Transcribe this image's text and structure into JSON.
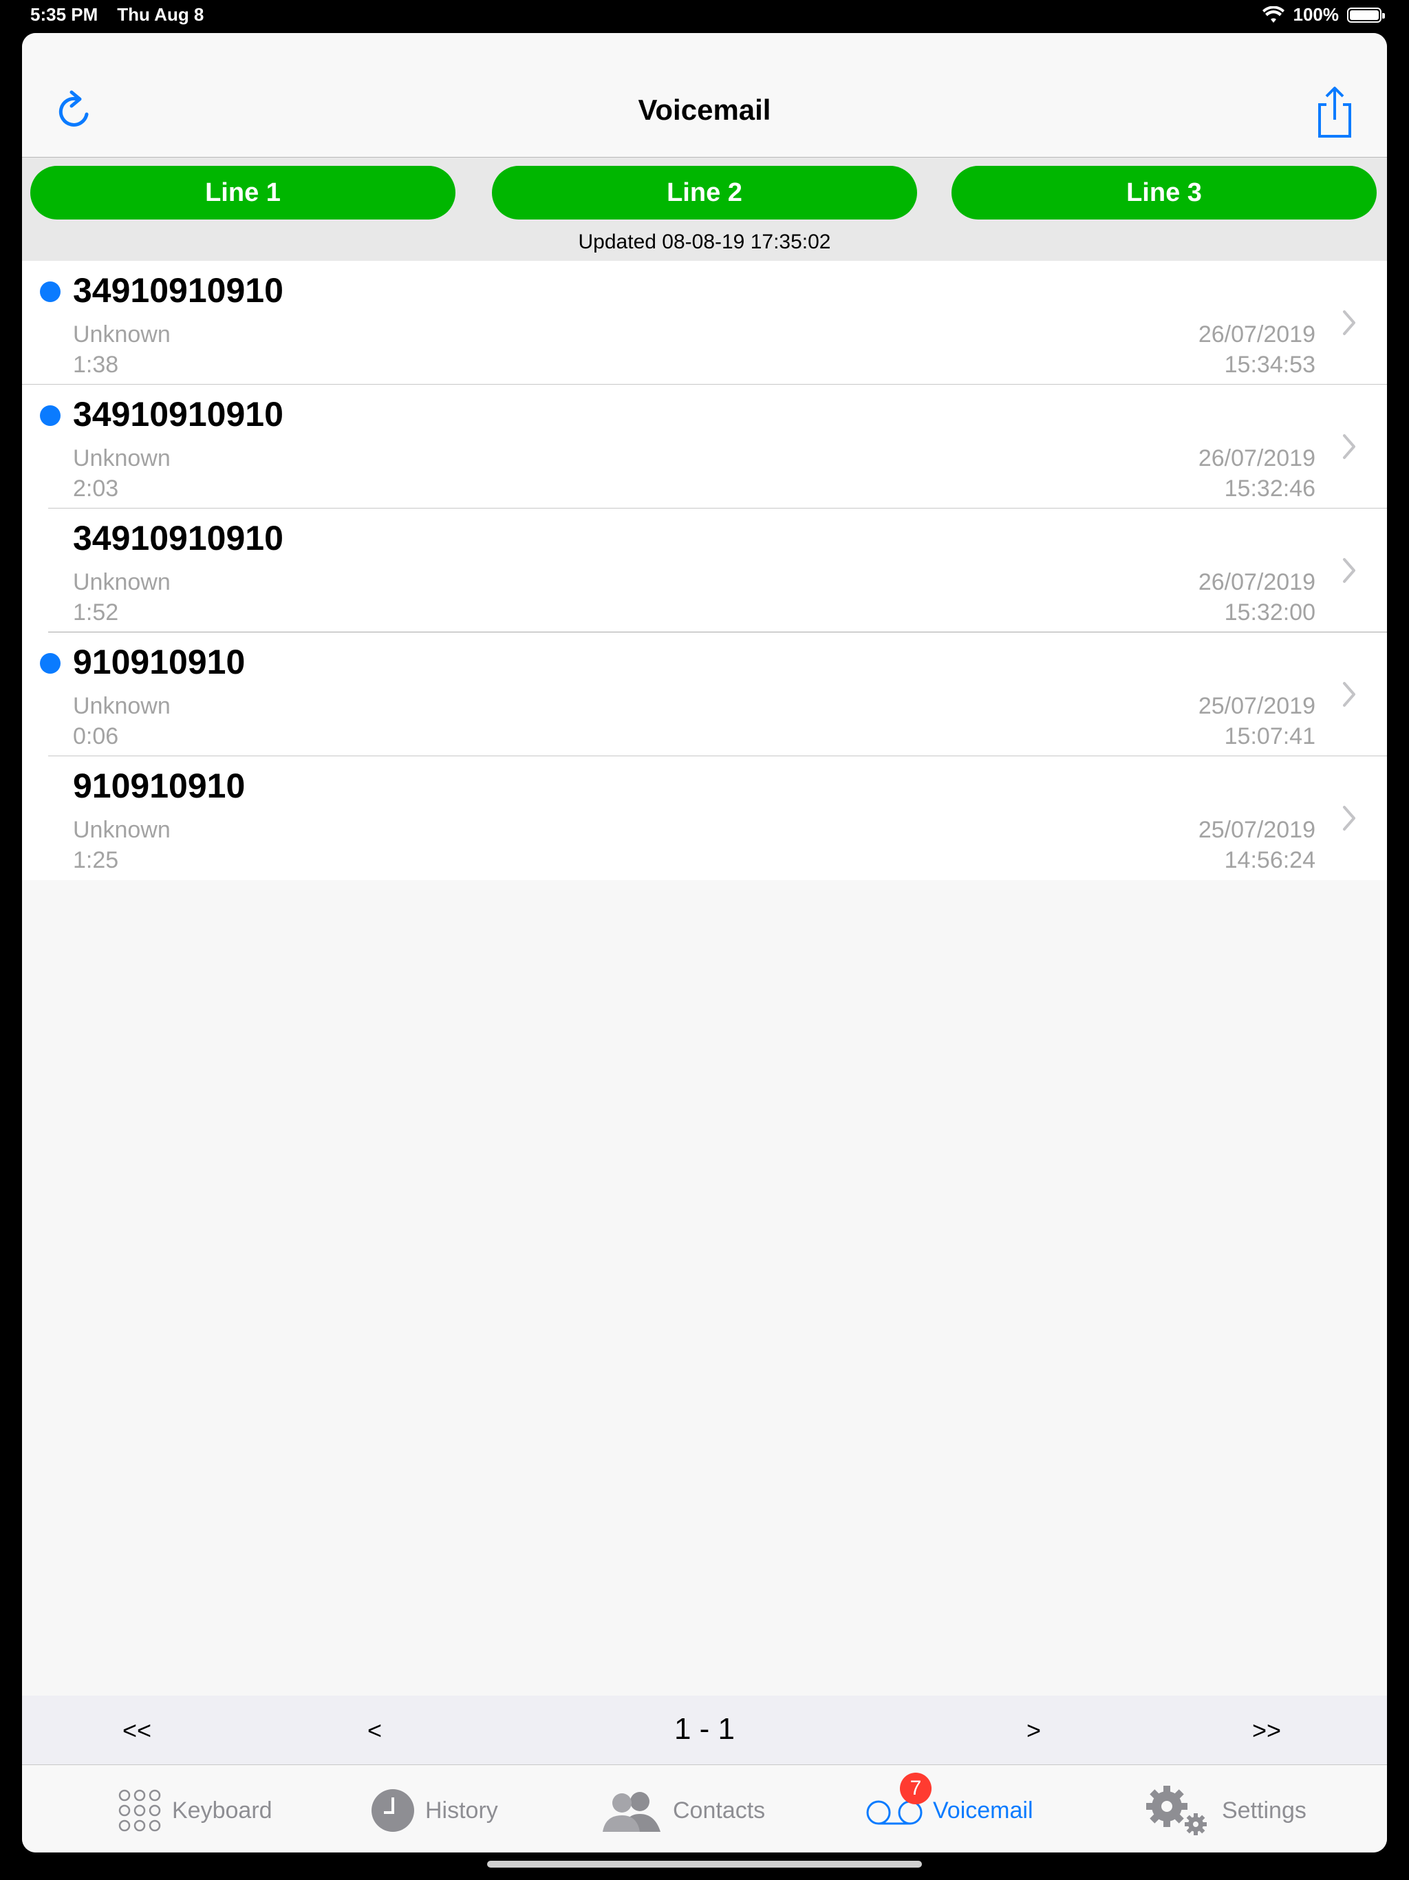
{
  "status_bar": {
    "time": "5:35 PM",
    "date": "Thu Aug 8",
    "battery": "100%",
    "battery_level": 1.0
  },
  "header": {
    "title": "Voicemail"
  },
  "lines": [
    {
      "label": "Line 1"
    },
    {
      "label": "Line 2"
    },
    {
      "label": "Line 3"
    }
  ],
  "updated_text": "Updated 08-08-19 17:35:02",
  "voicemails": [
    {
      "number": "34910910910",
      "name": "Unknown",
      "duration": "1:38",
      "date": "26/07/2019",
      "time": "15:34:53",
      "unread": true
    },
    {
      "number": "34910910910",
      "name": "Unknown",
      "duration": "2:03",
      "date": "26/07/2019",
      "time": "15:32:46",
      "unread": true
    },
    {
      "number": "34910910910",
      "name": "Unknown",
      "duration": "1:52",
      "date": "26/07/2019",
      "time": "15:32:00",
      "unread": false
    },
    {
      "number": "910910910",
      "name": "Unknown",
      "duration": "0:06",
      "date": "25/07/2019",
      "time": "15:07:41",
      "unread": true
    },
    {
      "number": "910910910",
      "name": "Unknown",
      "duration": "1:25",
      "date": "25/07/2019",
      "time": "14:56:24",
      "unread": false
    }
  ],
  "pager": {
    "first": "<<",
    "prev": "<",
    "range": "1 - 1",
    "next": ">",
    "last": ">>"
  },
  "tabs": {
    "keyboard": "Keyboard",
    "history": "History",
    "contacts": "Contacts",
    "voicemail": "Voicemail",
    "settings": "Settings",
    "voicemail_badge": "7"
  },
  "colors": {
    "accent": "#0a7bff",
    "line_green": "#00b600",
    "unread_dot": "#0a7bff",
    "badge": "#ff3b30"
  }
}
